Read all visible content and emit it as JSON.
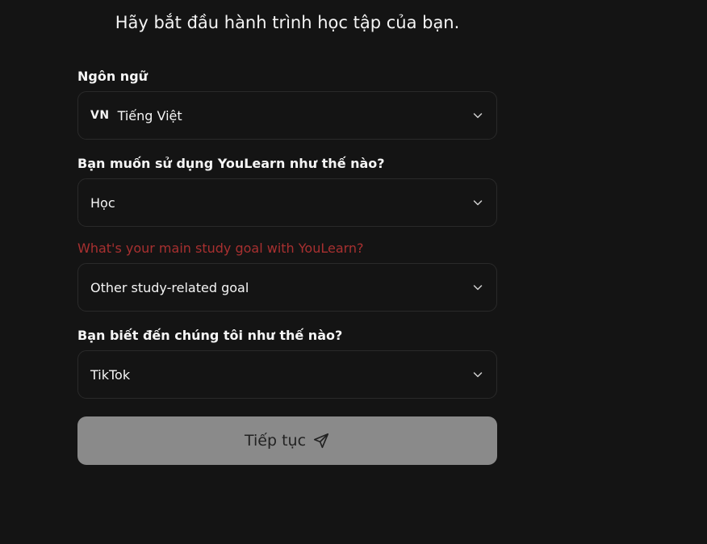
{
  "heading": "Hãy bắt đầu hành trình học tập của bạn.",
  "fields": [
    {
      "label": "Ngôn ngữ",
      "flag_code": "VN",
      "value": "Tiếng Việt",
      "error": false
    },
    {
      "label": "Bạn muốn sử dụng YouLearn như thế nào?",
      "value": "Học",
      "error": false
    },
    {
      "label": "What's your main study goal with YouLearn?",
      "value": "Other study-related goal",
      "error": true
    },
    {
      "label": "Bạn biết đến chúng tôi như thế nào?",
      "value": "TikTok",
      "error": false
    }
  ],
  "submit": {
    "label": "Tiếp tục",
    "icon": "send-icon",
    "disabled": true
  },
  "colors": {
    "background": "#141414",
    "error_label": "#a83030",
    "button_disabled": "#8a8a8a"
  }
}
